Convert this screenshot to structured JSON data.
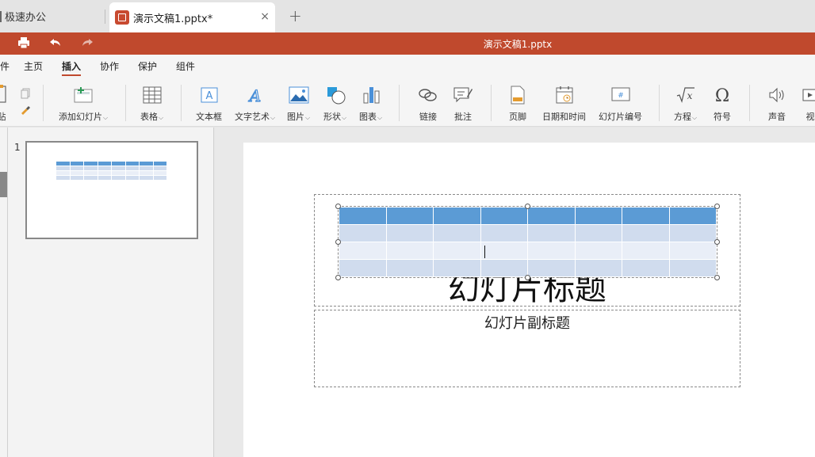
{
  "tabs": {
    "inactive_label": "极速办公",
    "active_label": "演示文稿1.pptx*",
    "close_glyph": "×",
    "add_glyph": "+"
  },
  "titlebar": {
    "document_title": "演示文稿1.pptx",
    "background_color": "#c0492d"
  },
  "menu": {
    "items": [
      "件",
      "主页",
      "插入",
      "协作",
      "保护",
      "组件"
    ],
    "active_index": 2
  },
  "ribbon": {
    "paste_label": "贴",
    "add_slide_label": "添加幻灯片",
    "table_label": "表格",
    "textbox_label": "文本框",
    "wordart_label": "文字艺术",
    "image_label": "图片",
    "shape_label": "形状",
    "chart_label": "图表",
    "link_label": "链接",
    "comment_label": "批注",
    "footer_label": "页脚",
    "datetime_label": "日期和时间",
    "slide_number_label": "幻灯片编号",
    "equation_label": "方程",
    "symbol_label": "符号",
    "audio_label": "声音",
    "video_label": "视"
  },
  "thumbnails": [
    {
      "number": "1"
    }
  ],
  "slide": {
    "title_text": "幻灯片标题",
    "subtitle_text": "幻灯片副标题",
    "table": {
      "rows": 4,
      "cols": 8
    }
  }
}
